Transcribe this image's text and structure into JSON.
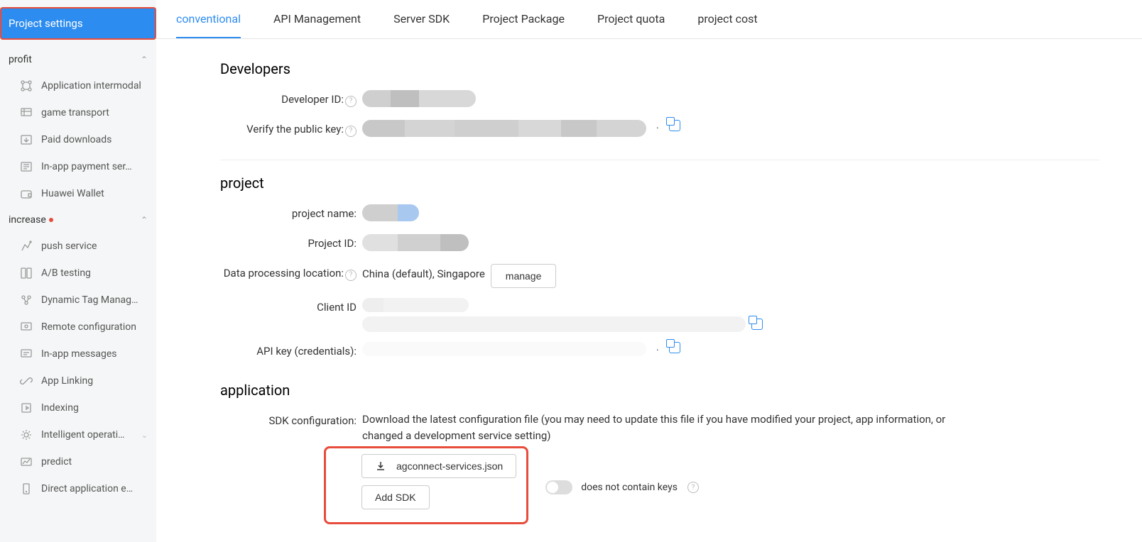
{
  "sidebar": {
    "header": "Project settings",
    "sections": [
      {
        "title": "profit",
        "items": [
          {
            "label": "Application intermodal",
            "icon": "intermodal"
          },
          {
            "label": "game transport",
            "icon": "game"
          },
          {
            "label": "Paid downloads",
            "icon": "paid"
          },
          {
            "label": "In-app payment ser…",
            "icon": "payment"
          },
          {
            "label": "Huawei Wallet",
            "icon": "wallet"
          }
        ]
      },
      {
        "title": "increase",
        "dot": true,
        "items": [
          {
            "label": "push service",
            "icon": "push"
          },
          {
            "label": "A/B testing",
            "icon": "ab"
          },
          {
            "label": "Dynamic Tag Manag…",
            "icon": "tag"
          },
          {
            "label": "Remote configuration",
            "icon": "remote"
          },
          {
            "label": "In-app messages",
            "icon": "messages"
          },
          {
            "label": "App Linking",
            "icon": "linking"
          },
          {
            "label": "Indexing",
            "icon": "indexing"
          },
          {
            "label": "Intelligent operati…",
            "icon": "intelligent",
            "sub": true
          },
          {
            "label": "predict",
            "icon": "predict"
          },
          {
            "label": "Direct application e…",
            "icon": "direct"
          }
        ]
      }
    ]
  },
  "tabs": [
    {
      "label": "conventional",
      "active": true
    },
    {
      "label": "API Management"
    },
    {
      "label": "Server SDK"
    },
    {
      "label": "Project Package"
    },
    {
      "label": "Project quota"
    },
    {
      "label": "project cost"
    }
  ],
  "developers": {
    "heading": "Developers",
    "developer_id_label": "Developer ID:",
    "verify_key_label": "Verify the public key:"
  },
  "project": {
    "heading": "project",
    "name_label": "project name:",
    "id_label": "Project ID:",
    "data_loc_label": "Data processing location:",
    "data_loc_value": "China (default), Singapore",
    "manage_btn": "manage",
    "client_id_label": "Client ID",
    "api_key_label": "API key (credentials):"
  },
  "application": {
    "heading": "application",
    "sdk_label": "SDK configuration:",
    "sdk_desc": "Download the latest configuration file (you may need to update this file if you have modified your project, app information, or changed a development service setting)",
    "download_btn": "agconnect-services.json",
    "add_sdk_btn": "Add SDK",
    "toggle_label": "does not contain keys"
  }
}
